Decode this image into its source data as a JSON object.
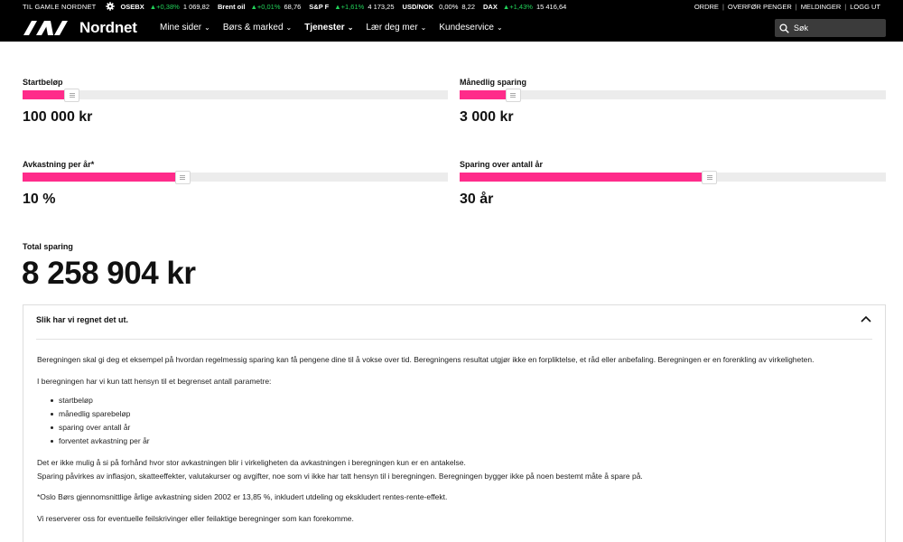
{
  "ticker": {
    "old_link": "TIL GAMLE NORDNET",
    "settings_icon": "gear-icon",
    "quotes": [
      {
        "name": "OSEBX",
        "change": "▲+0,38%",
        "value": "1 069,82",
        "direction": "up"
      },
      {
        "name": "Brent oil",
        "change": "▲+0,01%",
        "value": "68,76",
        "direction": "up"
      },
      {
        "name": "S&P F",
        "change": "▲+1,61%",
        "value": "4 173,25",
        "direction": "up"
      },
      {
        "name": "USD/NOK",
        "change": "0,00%",
        "value": "8,22",
        "direction": "flat"
      },
      {
        "name": "DAX",
        "change": "▲+1,43%",
        "value": "15 416,64",
        "direction": "up"
      }
    ],
    "links": [
      "ORDRE",
      "OVERFØR PENGER",
      "MELDINGER",
      "LOGG UT"
    ]
  },
  "nav": {
    "logo_text": "Nordnet",
    "menu": [
      {
        "label": "Mine sider",
        "bold": false
      },
      {
        "label": "Børs & marked",
        "bold": false
      },
      {
        "label": "Tjenester",
        "bold": true
      },
      {
        "label": "Lær deg mer",
        "bold": false
      },
      {
        "label": "Kundeservice",
        "bold": false
      }
    ],
    "search_placeholder": "Søk"
  },
  "calculator": {
    "start_amount": {
      "label": "Startbeløp",
      "value_text": "100 000 kr",
      "level_fraction": 0.1
    },
    "monthly_saving": {
      "label": "Månedlig sparing",
      "value_text": "3 000 kr",
      "level_fraction": 0.11
    },
    "annual_return": {
      "label": "Avkastning per år*",
      "value_text": "10 %",
      "level_fraction": 0.36
    },
    "saving_years": {
      "label": "Sparing over antall år",
      "value_text": "30 år",
      "level_fraction": 0.57
    }
  },
  "total": {
    "label": "Total sparing",
    "value": "8 258 904 kr"
  },
  "explanation": {
    "title": "Slik har vi regnet det ut.",
    "toggle_icon": "chevron-up-icon",
    "p1": "Beregningen skal gi deg et eksempel på hvordan regelmessig sparing kan få pengene dine til å vokse over tid. Beregningens resultat utgjør ikke en forpliktelse, et råd eller anbefaling. Beregningen er en forenkling av virkeligheten.",
    "p2": "I beregningen har vi kun tatt hensyn til et begrenset antall parametre:",
    "params": [
      "startbeløp",
      "månedlig sparebeløp",
      "sparing over antall år",
      "forventet avkastning per år"
    ],
    "p3a": "Det er ikke mulig å si på forhånd hvor stor avkastningen blir i virkeligheten da avkastningen i beregningen kun er en antakelse.",
    "p3b": "Sparing påvirkes av inflasjon, skatteeffekter, valutakurser og avgifter, noe som vi ikke har tatt hensyn til i beregningen. Beregningen bygger ikke på noen bestemt måte å spare på.",
    "p4": "*Oslo Børs gjennomsnittlige årlige avkastning siden 2002 er 13,85 %, inkludert utdeling og ekskludert rentes-rente-effekt.",
    "p5": "Vi reserverer oss for eventuelle feilskrivinger eller feilaktige beregninger som kan forekomme."
  }
}
